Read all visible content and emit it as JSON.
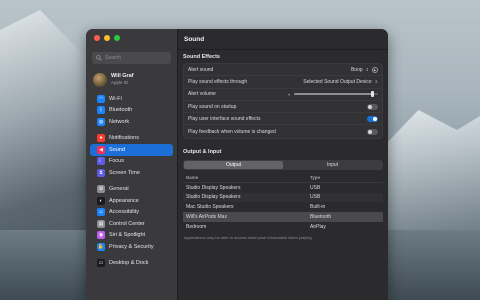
{
  "window": {
    "title": "Sound"
  },
  "sidebar": {
    "search_placeholder": "Search",
    "profile": {
      "name": "Will Graf",
      "subtitle": "Apple ID"
    },
    "groups": [
      [
        {
          "label": "Wi-Fi",
          "icon": "wifi-icon",
          "color": "#1a82fb"
        },
        {
          "label": "Bluetooth",
          "icon": "bluetooth-icon",
          "color": "#1a82fb"
        },
        {
          "label": "Network",
          "icon": "globe-icon",
          "color": "#1a82fb"
        }
      ],
      [
        {
          "label": "Notifications",
          "icon": "bell-icon",
          "color": "#ff3b30"
        },
        {
          "label": "Sound",
          "icon": "speaker-icon",
          "color": "#ff2d55",
          "selected": true
        },
        {
          "label": "Focus",
          "icon": "moon-icon",
          "color": "#5e5ce6"
        },
        {
          "label": "Screen Time",
          "icon": "hourglass-icon",
          "color": "#5e5ce6"
        }
      ],
      [
        {
          "label": "General",
          "icon": "gear-icon",
          "color": "#8e8e93"
        },
        {
          "label": "Appearance",
          "icon": "appearance-icon",
          "color": "#1c1c1e"
        },
        {
          "label": "Accessibility",
          "icon": "accessibility-icon",
          "color": "#1a82fb"
        },
        {
          "label": "Control Center",
          "icon": "control-center-icon",
          "color": "#8e8e93"
        },
        {
          "label": "Siri & Spotlight",
          "icon": "siri-icon",
          "color": "#bf5af2"
        },
        {
          "label": "Privacy & Security",
          "icon": "hand-icon",
          "color": "#1a82fb"
        }
      ],
      [
        {
          "label": "Desktop & Dock",
          "icon": "dock-icon",
          "color": "#1c1c1e"
        }
      ]
    ]
  },
  "sound_effects": {
    "section_title": "Sound Effects",
    "alert_sound": {
      "label": "Alert sound",
      "value": "Boop"
    },
    "play_through": {
      "label": "Play sound effects through",
      "value": "Selected Sound Output Device"
    },
    "alert_volume": {
      "label": "Alert volume",
      "level": 0.93
    },
    "startup": {
      "label": "Play sound on startup",
      "on": false
    },
    "ui_sounds": {
      "label": "Play user interface sound effects",
      "on": true
    },
    "feedback": {
      "label": "Play feedback when volume is changed",
      "on": false
    }
  },
  "output_input": {
    "section_title": "Output & Input",
    "tabs": [
      "Output",
      "Input"
    ],
    "active_tab": "Output",
    "columns": [
      "Name",
      "Type"
    ],
    "devices": [
      {
        "name": "Studio Display Speakers",
        "type": "USB"
      },
      {
        "name": "Studio Display Speakers",
        "type": "USB"
      },
      {
        "name": "Mac Studio Speakers",
        "type": "Built-in"
      },
      {
        "name": "Will's AirPods Max",
        "type": "Bluetooth",
        "selected": true
      },
      {
        "name": "Bedroom",
        "type": "AirPlay"
      }
    ],
    "footnote": "Applications may be able to access head pose information when playing"
  }
}
